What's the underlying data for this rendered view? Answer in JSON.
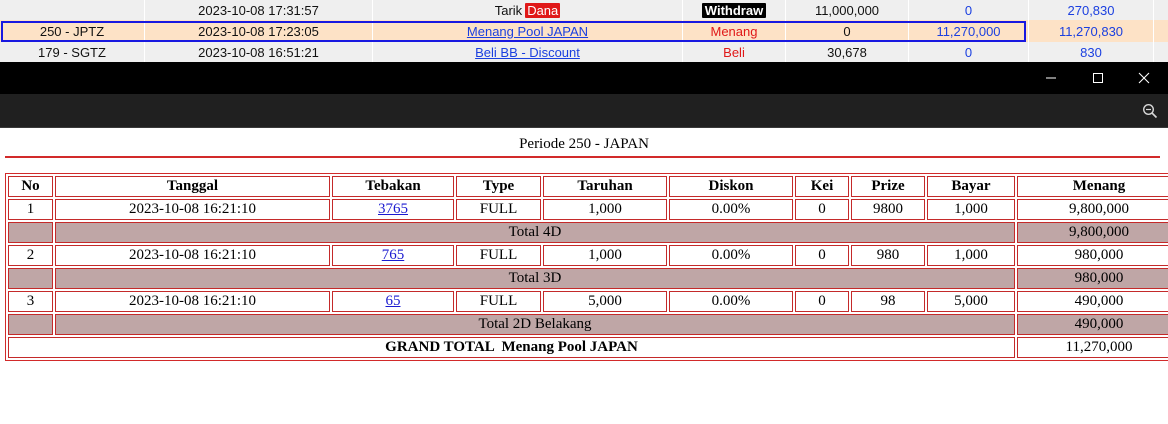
{
  "ledger": {
    "rows": [
      {
        "pasaran": "",
        "tanggal": "2023-10-08 17:31:57",
        "keterangan": "Tarik",
        "keterangan_badge": "Dana",
        "tipe": "Withdraw",
        "debit": "11,000,000",
        "kredit": "0",
        "saldo": "270,830"
      },
      {
        "pasaran": "250 - JPTZ",
        "tanggal": "2023-10-08 17:23:05",
        "keterangan": "Menang Pool JAPAN",
        "tipe": "Menang",
        "debit": "0",
        "kredit": "11,270,000",
        "saldo": "11,270,830"
      },
      {
        "pasaran": "179 - SGTZ",
        "tanggal": "2023-10-08 16:51:21",
        "keterangan": "Beli BB - Discount",
        "tipe": "Beli",
        "debit": "30,678",
        "kredit": "0",
        "saldo": "830"
      }
    ]
  },
  "window": {
    "icons": {
      "minimize": "minimize-icon",
      "maximize": "maximize-icon",
      "close": "close-icon",
      "zoom": "zoom-out-icon"
    }
  },
  "report": {
    "periode": "Periode 250 - JAPAN",
    "headers": {
      "no": "No",
      "tanggal": "Tanggal",
      "tebakan": "Tebakan",
      "type": "Type",
      "taruhan": "Taruhan",
      "diskon": "Diskon",
      "kei": "Kei",
      "prize": "Prize",
      "bayar": "Bayar",
      "menang": "Menang"
    },
    "rows": [
      {
        "no": "1",
        "tanggal": "2023-10-08 16:21:10",
        "tebakan": "3765",
        "type": "FULL",
        "taruhan": "1,000",
        "diskon": "0.00%",
        "kei": "0",
        "prize": "9800",
        "bayar": "1,000",
        "menang": "9,800,000"
      },
      {
        "no": "2",
        "tanggal": "2023-10-08 16:21:10",
        "tebakan": "765",
        "type": "FULL",
        "taruhan": "1,000",
        "diskon": "0.00%",
        "kei": "0",
        "prize": "980",
        "bayar": "1,000",
        "menang": "980,000"
      },
      {
        "no": "3",
        "tanggal": "2023-10-08 16:21:10",
        "tebakan": "65",
        "type": "FULL",
        "taruhan": "5,000",
        "diskon": "0.00%",
        "kei": "0",
        "prize": "98",
        "bayar": "5,000",
        "menang": "490,000"
      }
    ],
    "totals": [
      {
        "label": "Total 4D",
        "value": "9,800,000"
      },
      {
        "label": "Total 3D",
        "value": "980,000"
      },
      {
        "label": "Total 2D Belakang",
        "value": "490,000"
      }
    ],
    "grand_total": {
      "label": "GRAND TOTAL  Menang Pool JAPAN",
      "value": "11,270,000"
    }
  }
}
